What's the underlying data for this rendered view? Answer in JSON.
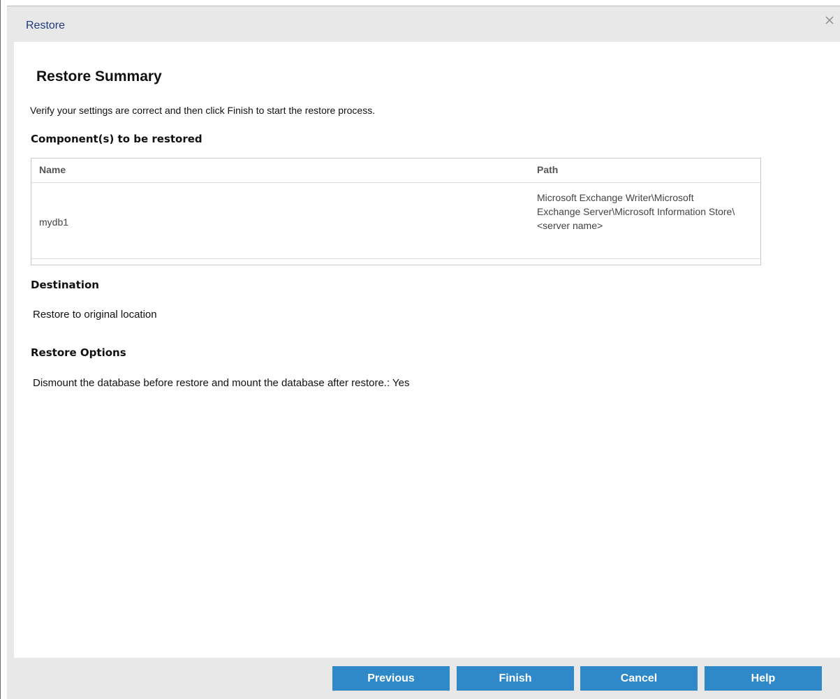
{
  "window": {
    "title": "Restore",
    "close_icon": "close-icon"
  },
  "summary": {
    "heading": "Restore Summary",
    "instruction": "Verify your settings are correct and then click Finish to start the restore process."
  },
  "components": {
    "section_title": "Component(s) to be restored",
    "columns": [
      "Name",
      "Path"
    ],
    "rows": [
      {
        "name": "mydb1",
        "path": "Microsoft Exchange Writer\\Microsoft Exchange Server\\Microsoft Information Store\\ <server name>"
      }
    ]
  },
  "destination": {
    "section_title": "Destination",
    "value": "Restore to original location"
  },
  "restore_options": {
    "section_title": "Restore Options",
    "value": "Dismount the database before restore and mount the database after restore.: Yes"
  },
  "footer": {
    "previous_label": "Previous",
    "finish_label": "Finish",
    "cancel_label": "Cancel",
    "help_label": "Help"
  },
  "colors": {
    "button_bg": "#2f89c9",
    "title_color": "#1f3a7a",
    "chrome_bg": "#e8e8e8"
  }
}
